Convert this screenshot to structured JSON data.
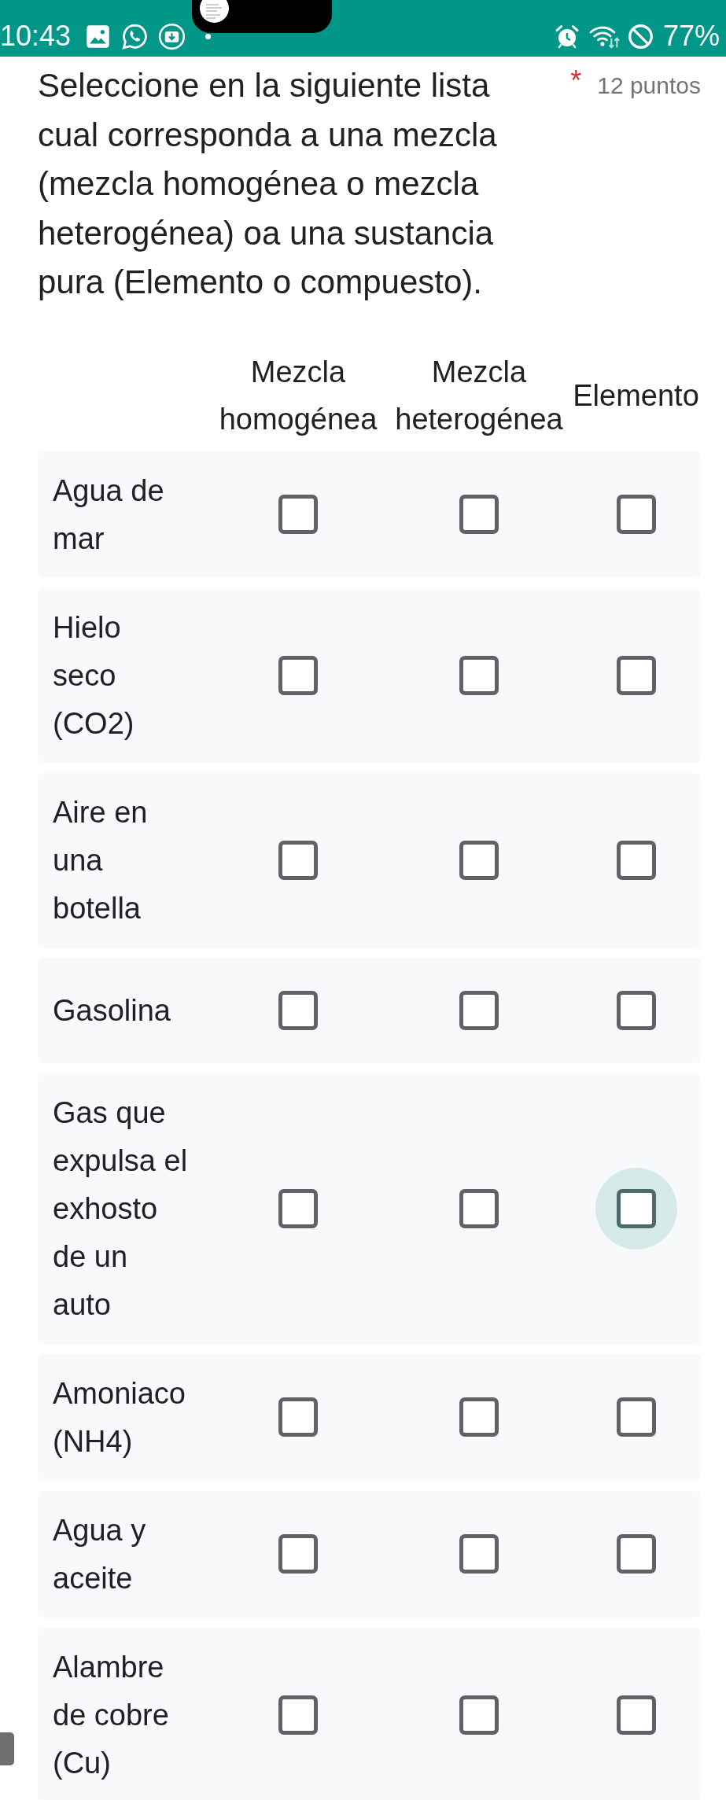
{
  "status_bar": {
    "time": "10:43",
    "battery": "77%"
  },
  "question": {
    "title": "Seleccione en la siguiente lista cual corresponda a una mezcla (mezcla homogénea o mezcla heterogénea) oa una sustancia pura (Elemento o compuesto).",
    "required_mark": "*",
    "points": "12 puntos"
  },
  "grid": {
    "columns": [
      "Mezcla homogénea",
      "Mezcla heterogénea",
      "Elemento"
    ],
    "rows": [
      {
        "label": "Agua de mar",
        "cells": [
          {
            "checked": false,
            "focused": false
          },
          {
            "checked": false,
            "focused": false
          },
          {
            "checked": false,
            "focused": false
          }
        ]
      },
      {
        "label": "Hielo seco (CO2)",
        "cells": [
          {
            "checked": false,
            "focused": false
          },
          {
            "checked": false,
            "focused": false
          },
          {
            "checked": false,
            "focused": false
          }
        ]
      },
      {
        "label": "Aire en una botella",
        "cells": [
          {
            "checked": false,
            "focused": false
          },
          {
            "checked": false,
            "focused": false
          },
          {
            "checked": false,
            "focused": false
          }
        ]
      },
      {
        "label": "Gasolina",
        "cells": [
          {
            "checked": false,
            "focused": false
          },
          {
            "checked": false,
            "focused": false
          },
          {
            "checked": false,
            "focused": false
          }
        ]
      },
      {
        "label": "Gas que expulsa el exhosto de un auto",
        "cells": [
          {
            "checked": false,
            "focused": false
          },
          {
            "checked": false,
            "focused": false
          },
          {
            "checked": false,
            "focused": true
          }
        ]
      },
      {
        "label": "Amoniaco (NH4)",
        "cells": [
          {
            "checked": false,
            "focused": false
          },
          {
            "checked": false,
            "focused": false
          },
          {
            "checked": false,
            "focused": false
          }
        ]
      },
      {
        "label": "Agua y aceite",
        "cells": [
          {
            "checked": false,
            "focused": false
          },
          {
            "checked": false,
            "focused": false
          },
          {
            "checked": false,
            "focused": false
          }
        ]
      },
      {
        "label": "Alambre de cobre (Cu)",
        "cells": [
          {
            "checked": false,
            "focused": false
          },
          {
            "checked": false,
            "focused": false
          },
          {
            "checked": false,
            "focused": false
          }
        ]
      }
    ]
  }
}
